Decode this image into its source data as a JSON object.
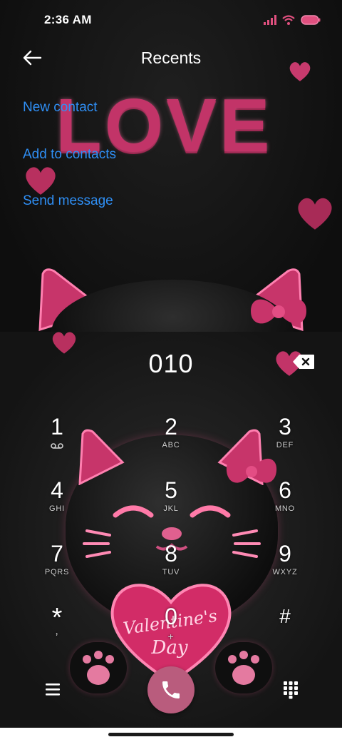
{
  "status_bar": {
    "time": "2:36 AM",
    "signal_icon": "signal-icon",
    "wifi_icon": "wifi-icon",
    "battery_icon": "battery-icon"
  },
  "header": {
    "title": "Recents",
    "back_icon": "back-arrow-icon"
  },
  "actions": [
    {
      "label": "New contact"
    },
    {
      "label": "Add to contacts"
    },
    {
      "label": "Send message"
    }
  ],
  "wallpaper": {
    "love_text": "LOVE",
    "heart_text_line1": "Valentine's",
    "heart_text_line2": "Day"
  },
  "dialer": {
    "number": "010",
    "backspace_icon": "backspace-icon",
    "keys": [
      {
        "digit": "1",
        "letters": ""
      },
      {
        "digit": "2",
        "letters": "ABC"
      },
      {
        "digit": "3",
        "letters": "DEF"
      },
      {
        "digit": "4",
        "letters": "GHI"
      },
      {
        "digit": "5",
        "letters": "JKL"
      },
      {
        "digit": "6",
        "letters": "MNO"
      },
      {
        "digit": "7",
        "letters": "PQRS"
      },
      {
        "digit": "8",
        "letters": "TUV"
      },
      {
        "digit": "9",
        "letters": "WXYZ"
      },
      {
        "digit": "*",
        "letters": ","
      },
      {
        "digit": "0",
        "letters": "+"
      },
      {
        "digit": "#",
        "letters": ""
      }
    ],
    "menu_icon": "menu-icon",
    "call_icon": "phone-icon",
    "keypad_icon": "dialpad-icon"
  },
  "colors": {
    "accent_link": "#2f8ff5",
    "call_button": "#b95c7d",
    "wallpaper_pink": "#c23468"
  }
}
